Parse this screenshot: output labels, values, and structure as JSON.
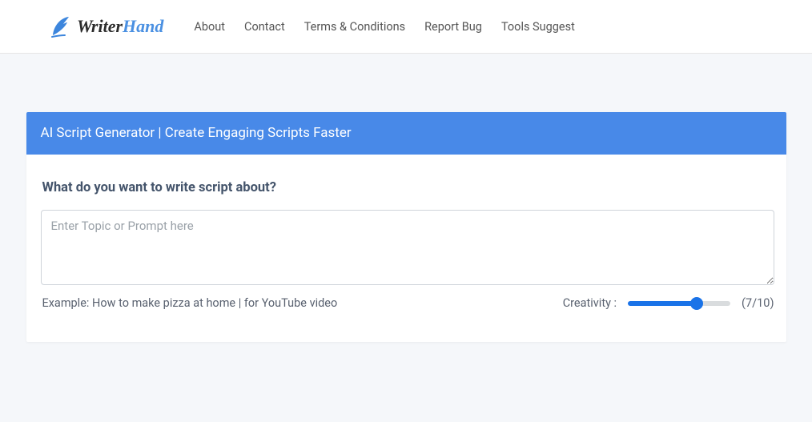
{
  "brand": {
    "part1": "Writer",
    "part2": "Hand"
  },
  "nav": {
    "about": "About",
    "contact": "Contact",
    "terms": "Terms & Conditions",
    "report": "Report Bug",
    "tools": "Tools Suggest"
  },
  "card": {
    "title": "AI Script Generator | Create Engaging Scripts Faster",
    "prompt_label": "What do you want to write script about?",
    "placeholder": "Enter Topic or Prompt here",
    "example": "Example: How to make pizza at home | for YouTube video"
  },
  "creativity": {
    "label": "Creativity :",
    "value": 7,
    "max": 10,
    "display": "(7/10)"
  }
}
